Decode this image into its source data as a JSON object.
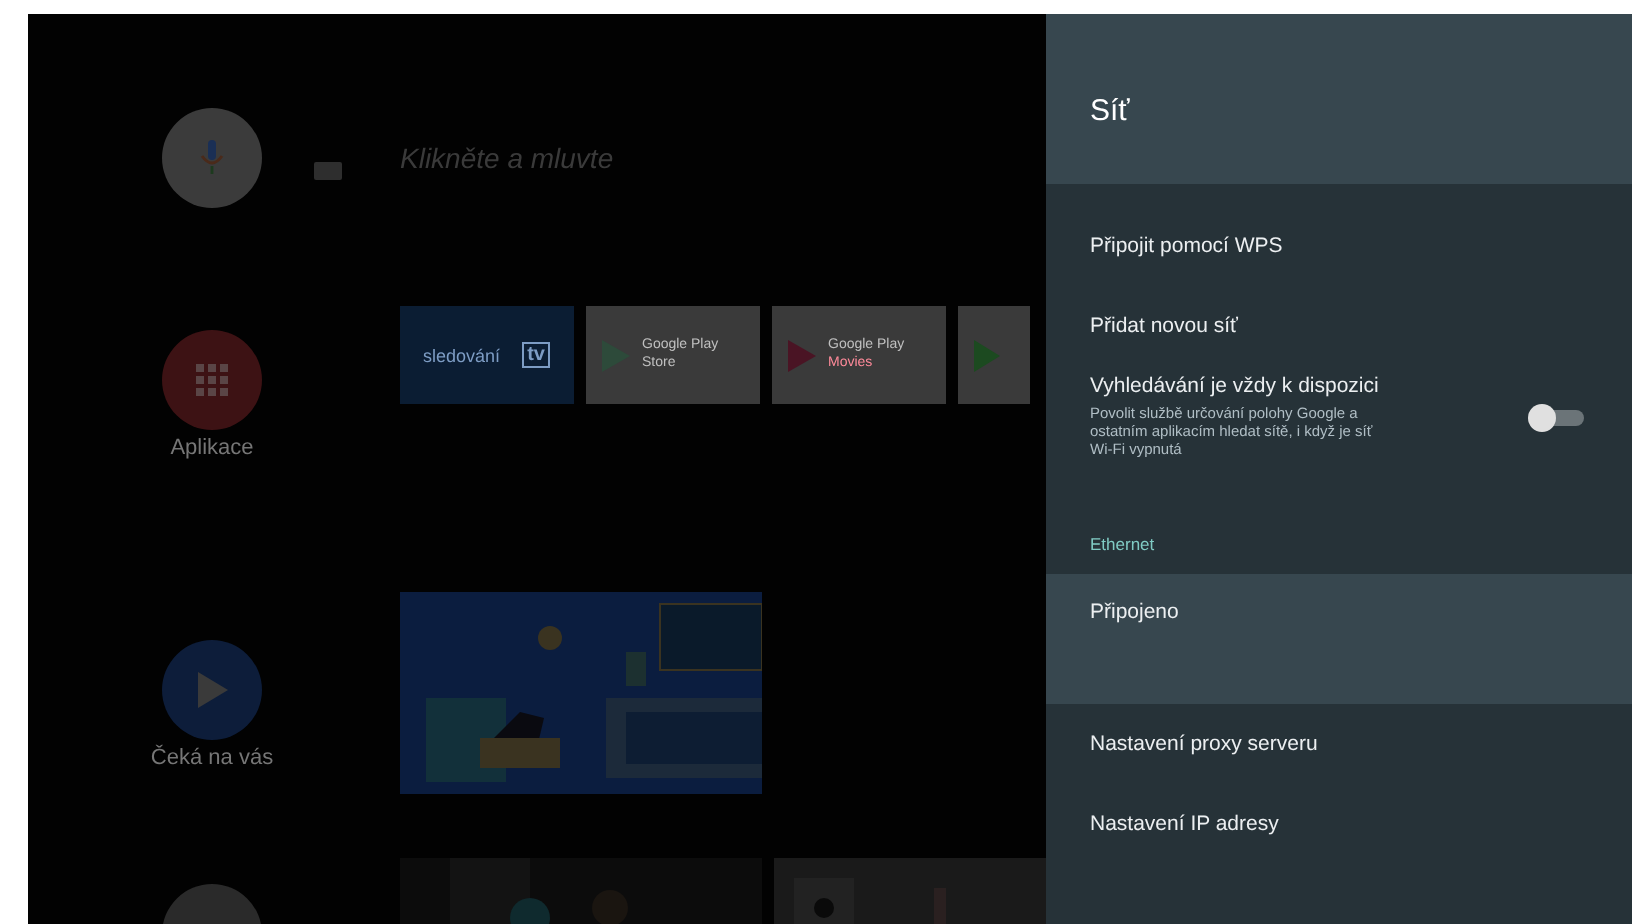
{
  "launcher": {
    "search_hint": "Klikněte a mluvte",
    "apps_label": "Aplikace",
    "apps_tiles": [
      {
        "kind": "tv",
        "line1": "sledování",
        "line2": "tv"
      },
      {
        "kind": "store",
        "line1": "Google Play",
        "line2": "Store"
      },
      {
        "kind": "movies",
        "line1": "Google Play",
        "line2": "Movies"
      },
      {
        "kind": "games"
      }
    ],
    "watch_label": "Čeká na vás"
  },
  "panel": {
    "title": "Síť",
    "items": [
      {
        "kind": "action",
        "label": "Připojit pomocí WPS",
        "selected": false
      },
      {
        "kind": "action",
        "label": "Přidat novou síť",
        "selected": false
      },
      {
        "kind": "toggle",
        "label": "Vyhledávání je vždy k dispozici",
        "description": "Povolit službě určování polohy Google a ostatním aplikacím hledat sítě, i když je síť Wi-Fi vypnutá",
        "on": false,
        "selected": false
      },
      {
        "kind": "header",
        "label": "Ethernet"
      },
      {
        "kind": "status",
        "label": "Připojeno",
        "selected": true
      },
      {
        "kind": "action",
        "label": "Nastavení proxy serveru",
        "selected": false
      },
      {
        "kind": "action",
        "label": "Nastavení IP adresy",
        "selected": false
      }
    ]
  }
}
